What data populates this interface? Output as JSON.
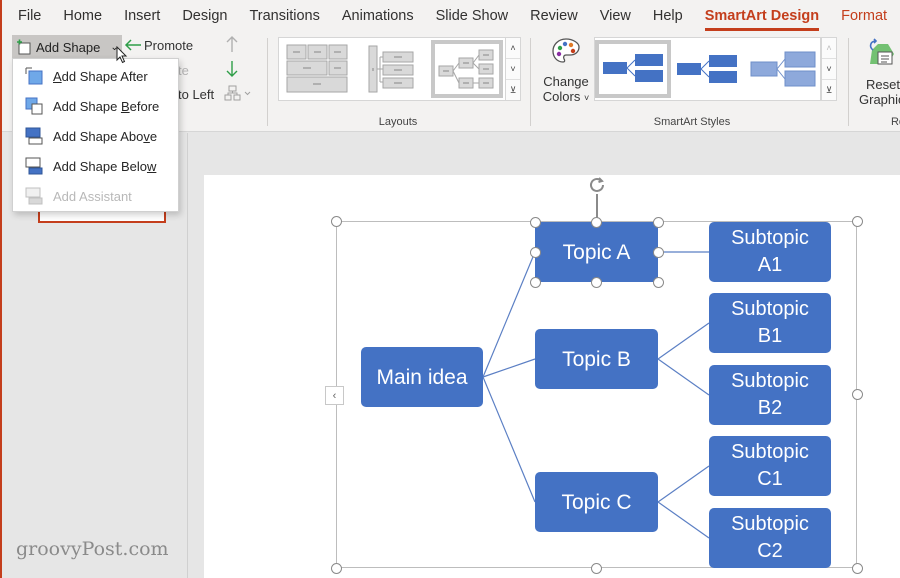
{
  "tabs": [
    {
      "label": "File"
    },
    {
      "label": "Home"
    },
    {
      "label": "Insert"
    },
    {
      "label": "Design"
    },
    {
      "label": "Transitions"
    },
    {
      "label": "Animations"
    },
    {
      "label": "Slide Show"
    },
    {
      "label": "Review"
    },
    {
      "label": "View"
    },
    {
      "label": "Help"
    },
    {
      "label": "SmartArt Design",
      "active": true
    },
    {
      "label": "Format",
      "contextual": true
    }
  ],
  "ribbon": {
    "add_shape_label": "Add Shape",
    "promote_label": "Promote",
    "demote_label_partial": "te",
    "right_to_left_partial": "to Left",
    "layouts_label": "Layouts",
    "change_colors_line1": "Change",
    "change_colors_line2": "Colors",
    "smartart_styles_label": "SmartArt Styles",
    "reset_line1": "Reset",
    "reset_line2": "Graphic",
    "reset_group_partial": "Re"
  },
  "dropdown": {
    "items": [
      {
        "pre": "",
        "key": "A",
        "post": "dd Shape After",
        "disabled": false
      },
      {
        "pre": "Add Shape ",
        "key": "B",
        "post": "efore",
        "disabled": false
      },
      {
        "pre": "Add Shape Abo",
        "key": "v",
        "post": "e",
        "disabled": false
      },
      {
        "pre": "Add Shape Belo",
        "key": "w",
        "post": "",
        "disabled": false
      },
      {
        "pre": "Add Assis",
        "key": "t",
        "post": "ant",
        "disabled": true
      }
    ]
  },
  "diagram": {
    "root": "Main idea",
    "topics": [
      {
        "label": "Topic A",
        "selected": true,
        "subtopics": [
          "Subtopic A1"
        ]
      },
      {
        "label": "Topic B",
        "selected": false,
        "subtopics": [
          "Subtopic B1",
          "Subtopic B2"
        ]
      },
      {
        "label": "Topic C",
        "selected": false,
        "subtopics": [
          "Subtopic C1",
          "Subtopic C2"
        ]
      }
    ],
    "node_color": "#4472c4",
    "line_color": "#5b7fc4"
  },
  "colors": {
    "accent": "#c43e1c",
    "ribbon_bg": "#f3f2f1",
    "canvas_bg": "#e6e6e6"
  },
  "watermark": "groovyPost.com"
}
